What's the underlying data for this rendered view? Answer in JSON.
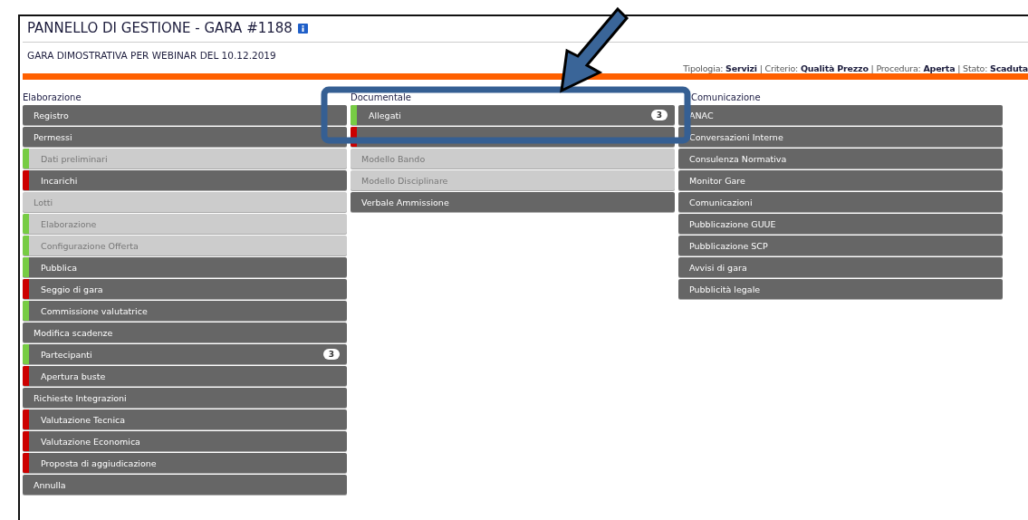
{
  "title": "PANNELLO DI GESTIONE - GARA #1188",
  "subtitle": "GARA DIMOSTRATIVA PER WEBINAR DEL 10.12.2019",
  "meta": "Tipologia: **Servizi** | Criterio: **Qualità Prezzo** | Procedura: **Aperta** | Stato: **Scaduta**",
  "columns": [
    {
      "heading": "Elaborazione",
      "items": [
        {
          "label": "Registro",
          "disabled": false
        },
        {
          "label": "Permessi",
          "disabled": false
        },
        {
          "label": "Dati preliminari",
          "color": "#77cc44",
          "disabled": true
        },
        {
          "label": "Incarichi",
          "color": "#cc0000",
          "disabled": false
        },
        {
          "label": "Lotti",
          "disabled": true
        },
        {
          "label": "Elaborazione",
          "color": "#77cc44",
          "disabled": true
        },
        {
          "label": "Configurazione Offerta",
          "color": "#77cc44",
          "disabled": true
        },
        {
          "label": "Pubblica",
          "color": "#77cc44",
          "disabled": false
        },
        {
          "label": "Seggio di gara",
          "color": "#cc0000",
          "disabled": false
        },
        {
          "label": "Commissione valutatrice",
          "color": "#77cc44",
          "disabled": false
        },
        {
          "label": "Modifica scadenze",
          "disabled": false
        },
        {
          "label": "Partecipanti",
          "color": "#77cc44",
          "disabled": false,
          "badge": "3"
        },
        {
          "label": "Apertura buste",
          "color": "#cc0000",
          "disabled": false
        },
        {
          "label": "Richieste Integrazioni",
          "disabled": false
        },
        {
          "label": "Valutazione Tecnica",
          "color": "#cc0000",
          "disabled": false
        },
        {
          "label": "Valutazione Economica",
          "color": "#cc0000",
          "disabled": false
        },
        {
          "label": "Proposta di aggiudicazione",
          "color": "#cc0000",
          "disabled": false
        },
        {
          "label": "Annulla",
          "disabled": false
        }
      ]
    },
    {
      "heading": "Documentale",
      "items": [
        {
          "label": "Allegati",
          "color": "#77cc44",
          "disabled": false,
          "badge": "3"
        },
        {
          "color": "#cc0000",
          "disabled": false
        },
        {
          "label": "Modello Bando",
          "disabled": true
        },
        {
          "label": "Modello Disciplinare",
          "disabled": true
        },
        {
          "label": "Verbale Ammissione",
          "disabled": false
        }
      ]
    },
    {
      "heading": "Comunicazione",
      "items": [
        {
          "label": "ANAC",
          "disabled": false
        },
        {
          "label": "Conversazioni Interne",
          "disabled": false
        },
        {
          "label": "Consulenza Normativa",
          "disabled": false
        },
        {
          "label": "Monitor Gare",
          "disabled": false
        },
        {
          "label": "Comunicazioni",
          "disabled": false
        },
        {
          "label": "Pubblicazione GUUE",
          "disabled": false
        },
        {
          "label": "Pubblicazione SCP",
          "disabled": false
        },
        {
          "label": "Avvisi di gara",
          "disabled": false
        },
        {
          "label": "Pubblicità legale",
          "disabled": false
        }
      ]
    }
  ]
}
